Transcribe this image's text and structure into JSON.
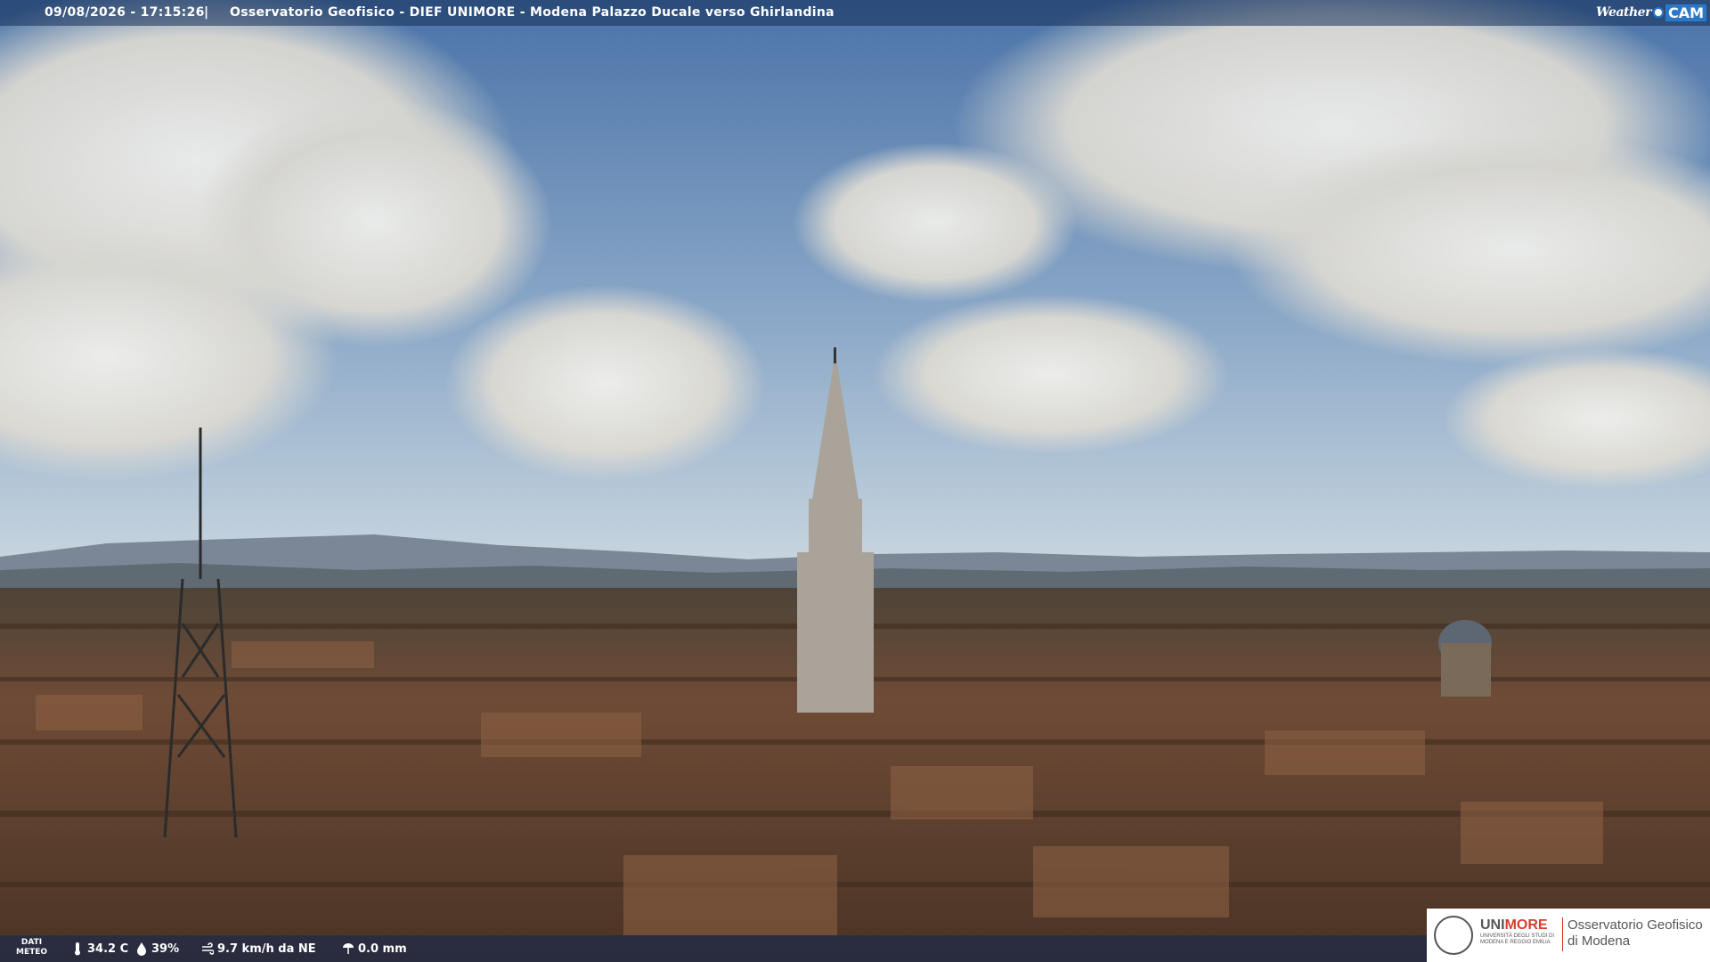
{
  "header": {
    "timestamp": "09/08/2026 - 17:15:26",
    "separator": "|",
    "title": "Osservatorio Geofisico - DIEF UNIMORE - Modena Palazzo Ducale verso Ghirlandina",
    "brand_weather": "Weather",
    "brand_cam": "CAM"
  },
  "meteo": {
    "label_line1": "DATI",
    "label_line2": "METEO",
    "temperature": "34.2 C",
    "humidity": "39%",
    "wind": "9.7 km/h da NE",
    "rain": "0.0 mm",
    "icons": [
      "thermometer-icon",
      "humidity-drop-icon",
      "wind-icon",
      "rain-gauge-icon"
    ]
  },
  "logo": {
    "uni_part1": "UNI",
    "uni_part2": "MORE",
    "uni_sub1": "UNIVERSITÀ DEGLI STUDI DI",
    "uni_sub2": "MODENA E REGGIO EMILIA",
    "obs_line1": "Osservatorio Geofisico",
    "obs_line2": "di Modena"
  },
  "colors": {
    "sky_top": "#4a73a8",
    "sky_horizon": "#c9d6df",
    "roof": "#6b4a35",
    "unimore_red": "#d3402f",
    "weathercam_blue": "#2b78c8"
  }
}
